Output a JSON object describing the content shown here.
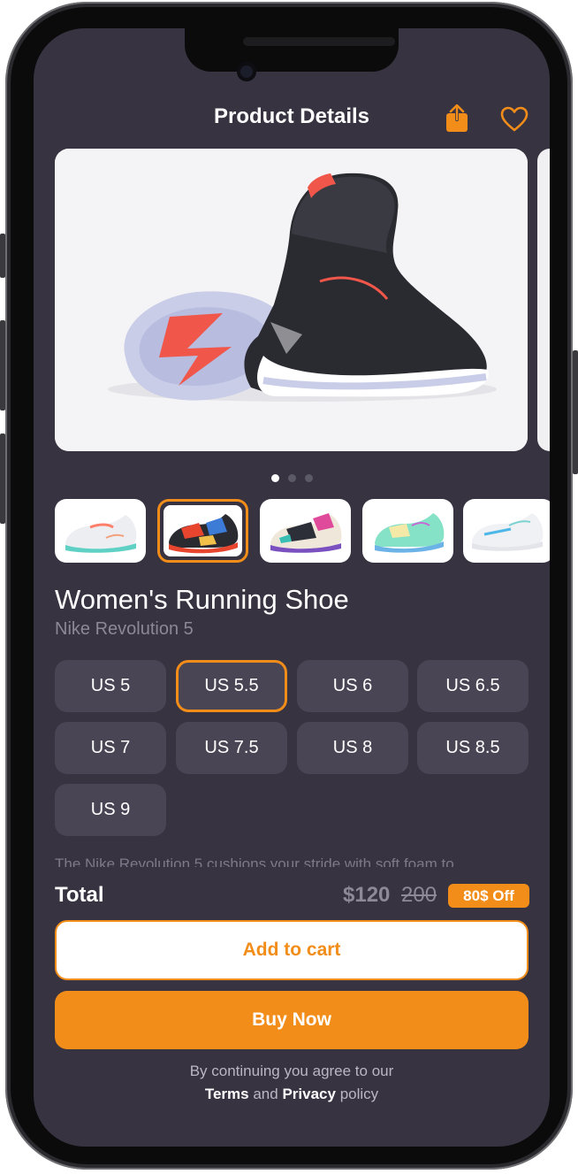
{
  "header": {
    "title": "Product Details"
  },
  "icons": {
    "share": "share-icon",
    "favorite": "heart-icon"
  },
  "colors": {
    "accent": "#f28d1a",
    "background": "#373341",
    "chip": "#494554"
  },
  "gallery": {
    "pages": 3,
    "active_page": 1,
    "thumbnail_count": 5,
    "selected_thumbnail": 2
  },
  "product": {
    "name": "Women's Running Shoe",
    "brand": "Nike Revolution 5"
  },
  "sizes": {
    "options": [
      "US 5",
      "US 5.5",
      "US 6",
      "US 6.5",
      "US 7",
      "US 7.5",
      "US 8",
      "US 8.5",
      "US 9"
    ],
    "selected": "US 5.5"
  },
  "description": "The Nike Revolution 5 cushions your stride with soft foam to",
  "checkout": {
    "total_label": "Total",
    "price": "$120",
    "old_price": "200",
    "discount": "80$ Off",
    "add_to_cart": "Add to cart",
    "buy_now": "Buy Now"
  },
  "legal": {
    "line1": "By continuing you agree to our",
    "terms": "Terms",
    "and": "and",
    "privacy": "Privacy",
    "policy": "policy"
  }
}
